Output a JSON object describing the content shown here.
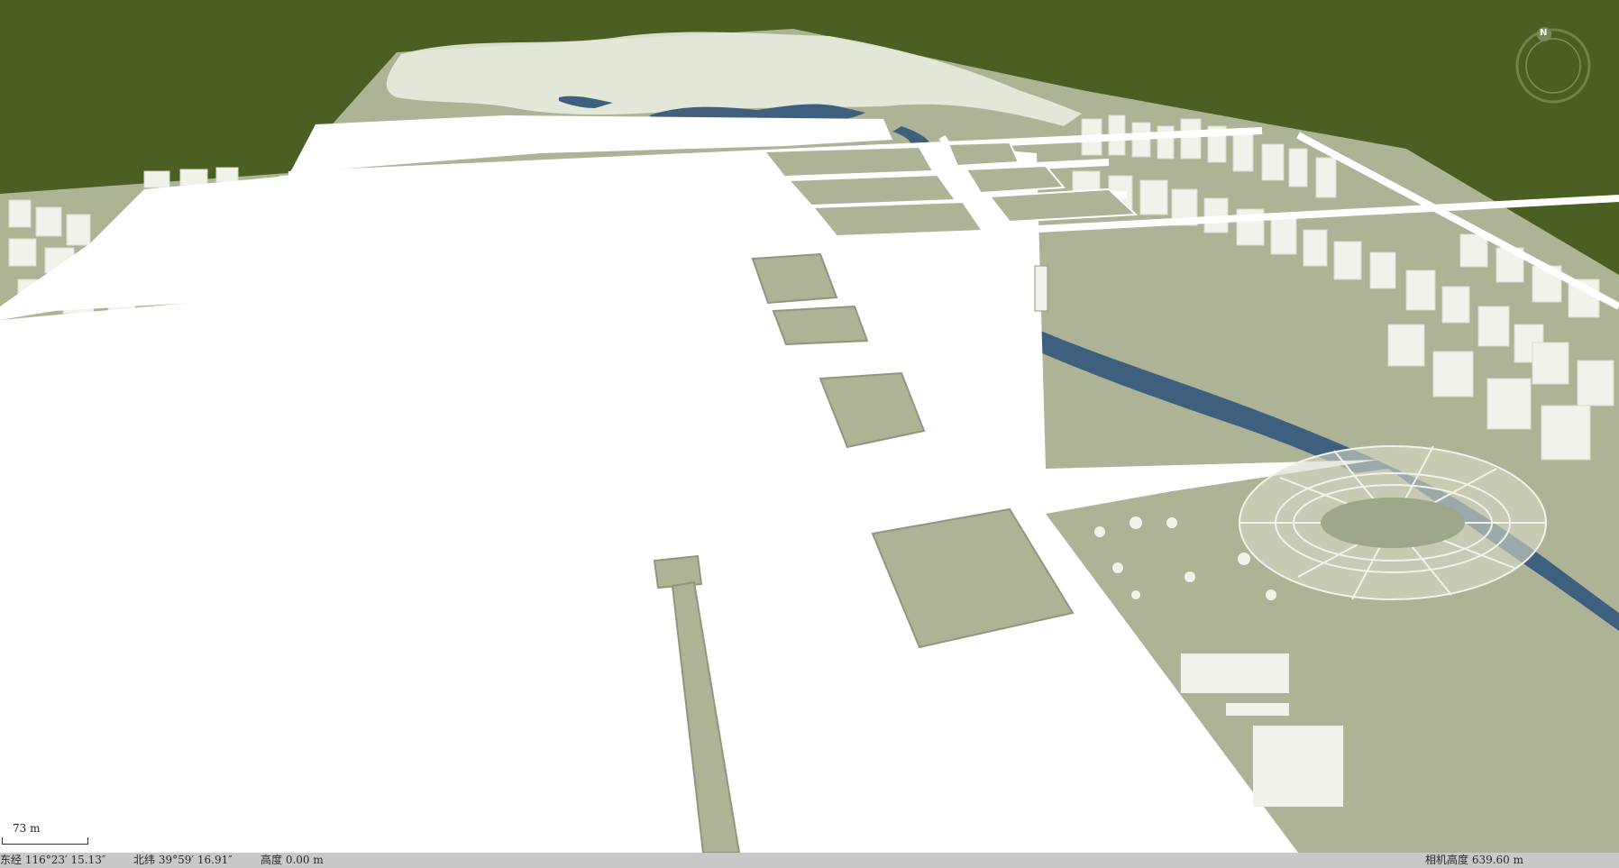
{
  "map": {
    "view": "3D scene — Olympic Park area",
    "colors": {
      "ground": "#4a5f21",
      "terrain": "#adb495",
      "water": "#3f5f7f",
      "buildings": "#f1f2ea",
      "accent": "#2c6b9a"
    }
  },
  "compass": {
    "north_label": "N",
    "icon": "compass-icon"
  },
  "scale": {
    "label": "73 m"
  },
  "status": {
    "longitude": "东经 116°23′ 15.13″",
    "latitude": "北纬 39°59′ 16.91″",
    "height": "高度 0.00 m",
    "camera_height": "相机高度 639.60 m"
  }
}
